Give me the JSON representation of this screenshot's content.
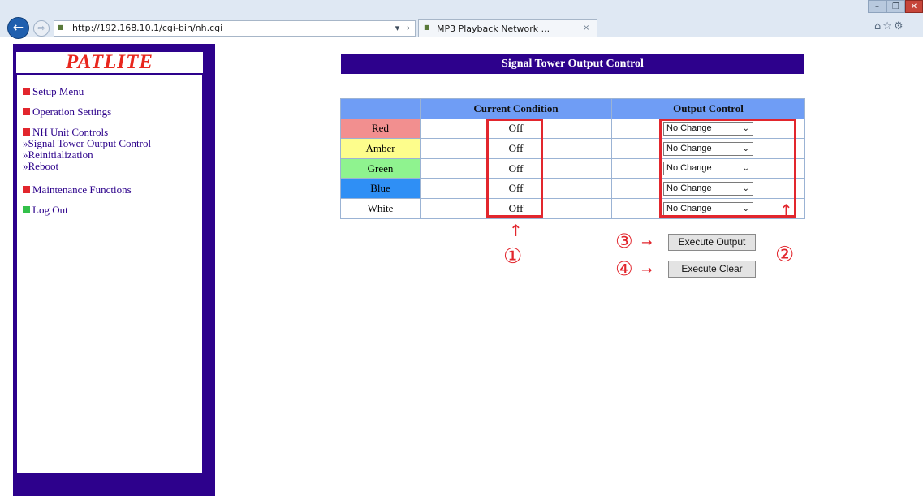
{
  "browser": {
    "url": "http://192.168.10.1/cgi-bin/nh.cgi",
    "tab_title": "MP3 Playback Network ...",
    "tab_close": "×",
    "back_icon": "←",
    "forward_icon": "⇨",
    "address_controls": "▾ →",
    "right_icons": "⌂☆⚙"
  },
  "window_controls": {
    "minimize": "–",
    "maximize": "❐",
    "close": "✕"
  },
  "sidebar": {
    "logo": "PATLITE",
    "items": [
      {
        "label": "Setup Menu",
        "color": "#e2262d"
      },
      {
        "label": "Operation Settings",
        "color": "#e2262d"
      },
      {
        "label": "NH Unit Controls",
        "color": "#e2262d"
      },
      {
        "label": "Maintenance Functions",
        "color": "#e2262d"
      },
      {
        "label": "Log Out",
        "color": "#33c04a"
      }
    ],
    "sub_items": [
      "»Signal Tower Output Control",
      "»Reinitialization",
      "»Reboot"
    ]
  },
  "main": {
    "title": "Signal Tower Output Control",
    "columns": [
      "",
      "Current Condition",
      "Output Control"
    ],
    "rows": [
      {
        "lamp": "Red",
        "color": "#f28f8f",
        "condition": "Off",
        "output": "No Change"
      },
      {
        "lamp": "Amber",
        "color": "#fdfd8c",
        "condition": "Off",
        "output": "No Change"
      },
      {
        "lamp": "Green",
        "color": "#8ff38f",
        "condition": "Off",
        "output": "No Change"
      },
      {
        "lamp": "Blue",
        "color": "#2f8ff5",
        "condition": "Off",
        "output": "No Change"
      },
      {
        "lamp": "White",
        "color": "#ffffff",
        "condition": "Off",
        "output": "No Change"
      }
    ],
    "execute_output_label": "Execute Output",
    "execute_clear_label": "Execute Clear"
  },
  "annotations": {
    "n1": "①",
    "n2": "②",
    "n3": "③",
    "n4": "④",
    "arrow_up": "↑",
    "arrow_right": "→",
    "color": "#e2262d"
  }
}
